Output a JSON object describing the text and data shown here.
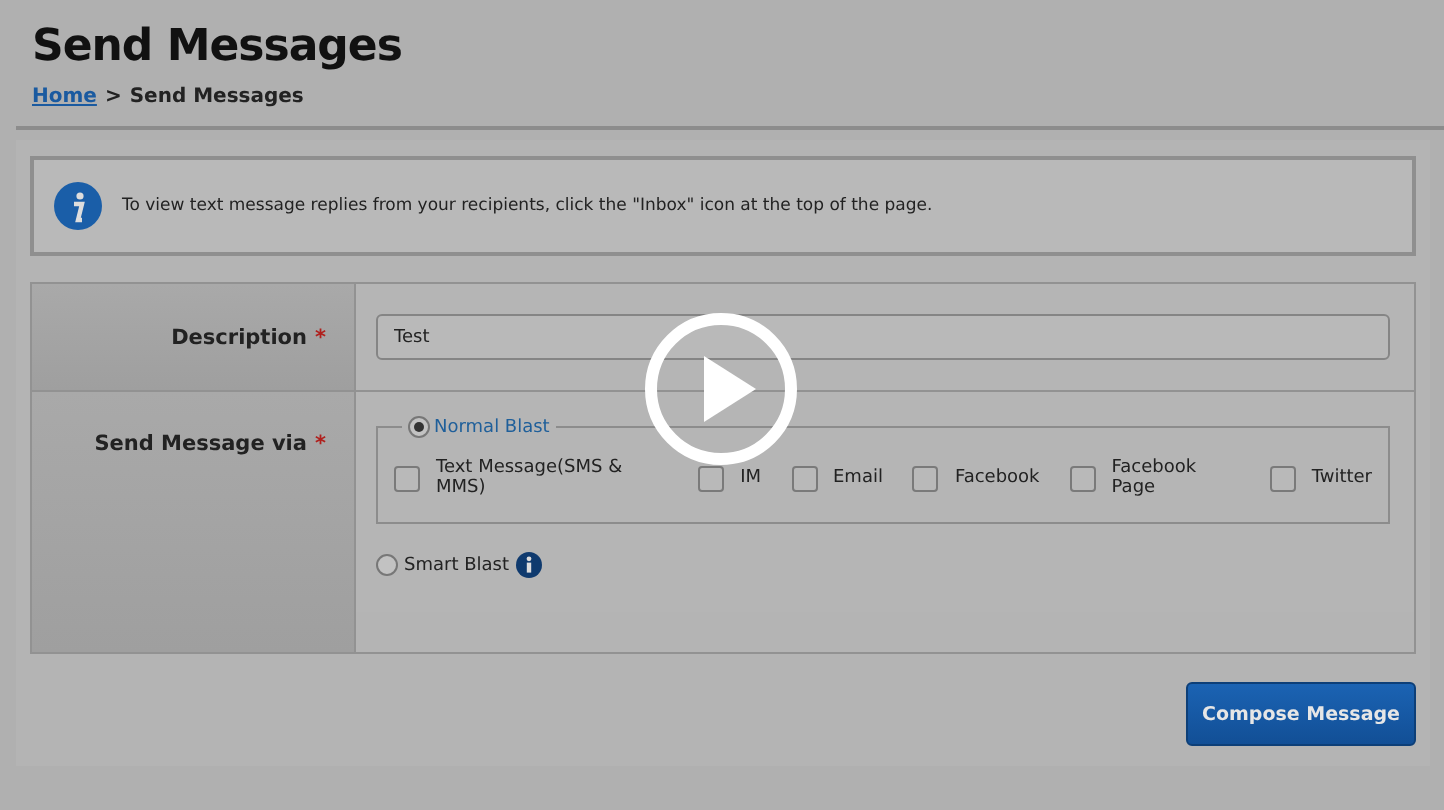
{
  "page": {
    "title": "Send Messages",
    "breadcrumb": [
      {
        "label": "Home",
        "kind": "link"
      },
      {
        "label": ">",
        "kind": "separator"
      },
      {
        "label": "Send Messages",
        "kind": "current"
      }
    ]
  },
  "info": {
    "text": "To view text message replies from your recipients, click the \"Inbox\" icon at the top of the page."
  },
  "form": {
    "description": {
      "label": "Description",
      "required_mark": "*",
      "value": "Test"
    },
    "send_via": {
      "label": "Send Message via",
      "required_mark": "*",
      "options": [
        {
          "label": "Normal Blast",
          "selected": true,
          "channels": [
            {
              "label": "Text Message(SMS & MMS)",
              "checked": false
            },
            {
              "label": "IM",
              "checked": false
            },
            {
              "label": "Email",
              "checked": false
            },
            {
              "label": "Facebook",
              "checked": false
            },
            {
              "label": "Facebook Page",
              "checked": false
            },
            {
              "label": "Twitter",
              "checked": false
            }
          ]
        },
        {
          "label": "Smart Blast",
          "selected": false
        }
      ]
    }
  },
  "compose_button": "Compose Message"
}
